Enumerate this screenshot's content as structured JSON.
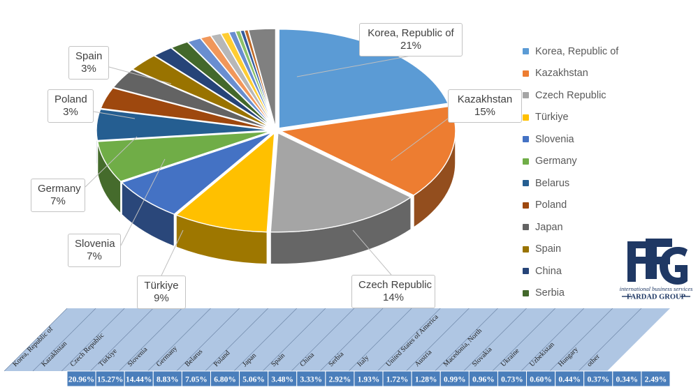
{
  "chart_data": {
    "type": "pie",
    "title": "",
    "three_d": true,
    "legend_position": "right",
    "categories": [
      "Korea, Republic of",
      "Kazakhstan",
      "Czech Republic",
      "Türkiye",
      "Slovenia",
      "Germany",
      "Belarus",
      "Poland",
      "Japan",
      "Spain",
      "China",
      "Serbia",
      "Italy",
      "United States of America",
      "Austria",
      "Macedonia, North",
      "Slovakia",
      "Ukraine",
      "Uzbekistan",
      "Hungary",
      "other"
    ],
    "values": [
      20.96,
      15.27,
      14.44,
      8.83,
      7.05,
      6.8,
      5.06,
      3.48,
      3.33,
      2.92,
      1.93,
      1.72,
      1.28,
      0.99,
      0.96,
      0.73,
      0.6,
      0.44,
      0.37,
      0.34,
      2.49
    ],
    "value_labels": [
      "20.96%",
      "15.27%",
      "14.44%",
      "8.83%",
      "7.05%",
      "6.80%",
      "5.06%",
      "3.48%",
      "3.33%",
      "2.92%",
      "1.93%",
      "1.72%",
      "1.28%",
      "0.99%",
      "0.96%",
      "0.73%",
      "0.60%",
      "0.44%",
      "0.37%",
      "0.34%",
      "2.49%"
    ],
    "colors": [
      "#5B9BD5",
      "#ED7D31",
      "#A5A5A5",
      "#FFC000",
      "#4472C4",
      "#70AD47",
      "#255E91",
      "#9E480E",
      "#636363",
      "#997300",
      "#264478",
      "#43682B",
      "#698ED0",
      "#F1975A",
      "#B7B7B7",
      "#FFCD33",
      "#698ED0",
      "#8CC168",
      "#335B9E",
      "#BF6A28",
      "#808080"
    ],
    "xlabel": "",
    "ylabel": ""
  },
  "callouts": [
    {
      "name": "Korea, Republic of",
      "pct": "21%"
    },
    {
      "name": "Kazakhstan",
      "pct": "15%"
    },
    {
      "name": "Czech Republic",
      "pct": "14%"
    },
    {
      "name": "Türkiye",
      "pct": "9%"
    },
    {
      "name": "Slovenia",
      "pct": "7%"
    },
    {
      "name": "Germany",
      "pct": "7%"
    },
    {
      "name": "Poland",
      "pct": "3%"
    },
    {
      "name": "Spain",
      "pct": "3%"
    }
  ],
  "legend": {
    "items": [
      {
        "label": "Korea, Republic of",
        "color": "#5B9BD5"
      },
      {
        "label": "Kazakhstan",
        "color": "#ED7D31"
      },
      {
        "label": "Czech Republic",
        "color": "#A5A5A5"
      },
      {
        "label": "Türkiye",
        "color": "#FFC000"
      },
      {
        "label": "Slovenia",
        "color": "#4472C4"
      },
      {
        "label": "Germany",
        "color": "#70AD47"
      },
      {
        "label": "Belarus",
        "color": "#255E91"
      },
      {
        "label": "Poland",
        "color": "#9E480E"
      },
      {
        "label": "Japan",
        "color": "#636363"
      },
      {
        "label": "Spain",
        "color": "#997300"
      },
      {
        "label": "China",
        "color": "#264478"
      },
      {
        "label": "Serbia",
        "color": "#43682B"
      }
    ]
  },
  "logo": {
    "monogram": "FG",
    "tagline": "international business services",
    "company": "FARDAD GROUP",
    "color": "#1F3864"
  },
  "table": {
    "headers": [
      "Korea, Republic of",
      "Kazakhstan",
      "Czech Republic",
      "Türkiye",
      "Slovenia",
      "Germany",
      "Belarus",
      "Poland",
      "Japan",
      "Spain",
      "China",
      "Serbia",
      "Italy",
      "United States of America",
      "Austria",
      "Macedonia, North",
      "Slovakia",
      "Ukraine",
      "Uzbekistan",
      "Hungary",
      "other"
    ],
    "values": [
      "20.96%",
      "15.27%",
      "14.44%",
      "8.83%",
      "7.05%",
      "6.80%",
      "5.06%",
      "3.48%",
      "3.33%",
      "2.92%",
      "1.93%",
      "1.72%",
      "1.28%",
      "0.99%",
      "0.96%",
      "0.73%",
      "0.60%",
      "0.44%",
      "0.37%",
      "0.34%",
      "2.49%"
    ],
    "header_fill": "#AFC6E3",
    "value_fill": "#4A7EBB"
  }
}
